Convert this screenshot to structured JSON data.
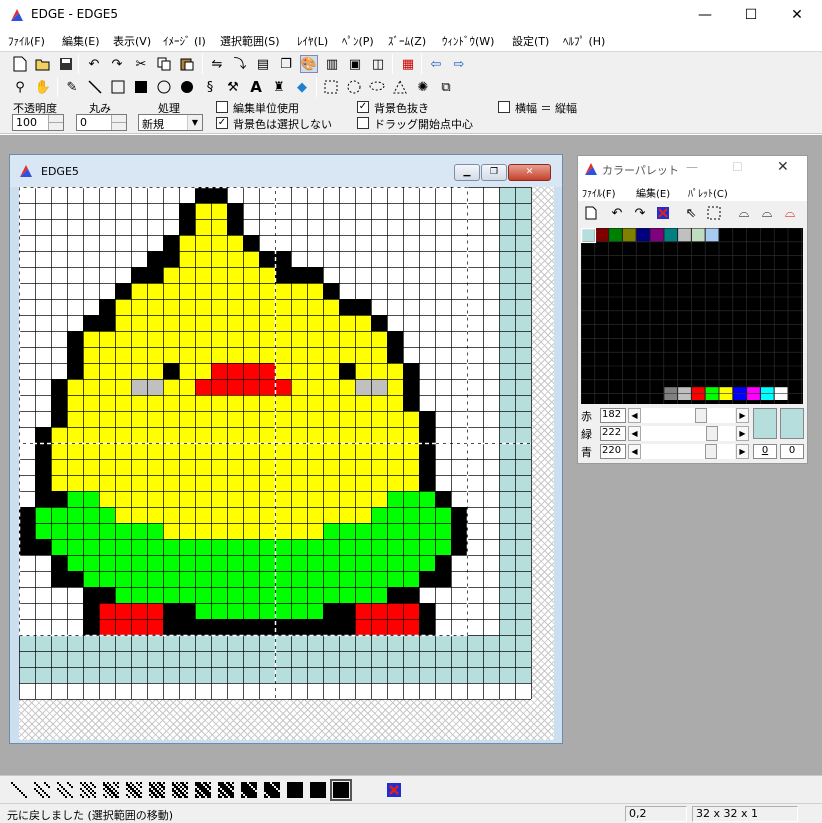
{
  "app": {
    "title": "EDGE - EDGE5",
    "min_glyph": "—",
    "max_glyph": "☐",
    "close_glyph": "✕"
  },
  "menu": [
    "ﾌｧｲﾙ(F)",
    "編集(E)",
    "表示(V)",
    "ｲﾒｰｼﾞ (I)",
    "選択範囲(S)",
    "ﾚｲﾔ(L)",
    "ﾍﾟﾝ(P)",
    "ｽﾞｰﾑ(Z)",
    "ｳｨﾝﾄﾞｳ(W)",
    "設定(T)",
    "ﾍﾙﾌﾟ (H)"
  ],
  "toolbar1_icons": [
    "new-icon",
    "open-icon",
    "save-icon",
    "undo-icon",
    "redo-icon",
    "cut-icon",
    "copy-icon",
    "paste-icon",
    "flip-h-icon",
    "flip-v-icon",
    "tile-icon",
    "layer-icon",
    "palette-icon",
    "film-icon",
    "image-icon",
    "frame-icon",
    "grid-icon",
    "prev-icon",
    "next-icon"
  ],
  "toolbar2_icons": [
    "zoom-icon",
    "hand-icon",
    "pencil-icon",
    "line-icon",
    "rect-icon",
    "fill-rect-icon",
    "ellipse-icon",
    "fill-ellipse-icon",
    "curve-icon",
    "hammer-icon",
    "text-icon",
    "spray-icon",
    "bucket-icon",
    "rect-select-icon",
    "ellipse-select-icon",
    "lasso-select-icon",
    "poly-select-icon",
    "magic-select-icon",
    "move-select-icon"
  ],
  "options": {
    "opacity_label": "不透明度",
    "opacity_value": "100",
    "round_label": "丸み",
    "round_value": "0",
    "process_label": "処理",
    "process_value": "新規",
    "edit_unit_label": "編集単位使用",
    "edit_unit_checked": false,
    "no_bg_select_label": "背景色は選択しない",
    "no_bg_select_checked": true,
    "bg_clear_label": "背景色抜き",
    "bg_clear_checked": true,
    "drag_center_label": "ドラッグ開始点中心",
    "drag_center_checked": false,
    "aspect_label": "横幅 ＝ 縦幅",
    "aspect_checked": false
  },
  "editor": {
    "title": "EDGE5",
    "canvas_size": 32
  },
  "sprite": {
    "colors": {
      ".": "#ffffff",
      "K": "#000000",
      "Y": "#ffff00",
      "G": "#00ff00",
      "R": "#ff0000",
      "A": "#c0c0c0",
      "B": "#b6dedc",
      "N": "#ffffff"
    },
    "rows": [
      "...........KK.................BB",
      "..........KYYK................BB",
      "..........KYYK................BB",
      ".........KYYYYK...............BB",
      "........KKYYYYYKK.............BB",
      ".......KKYYYYYYYKKK...........BB",
      "......KYYYYYYYYYYYYK..........BB",
      ".....KYYYYYYYYYYYYYYKK........BB",
      "....KKYYYYYYYYYYYYYYYYK.......BB",
      "...KYYYYYYYYYYYYYYYYYYYK......BB",
      "...KYYYYYYYYYYYYYYYYYYYK......BB",
      "...KYYYYYKYYRRRRYYYYKYYYK.....BB",
      "..KYYYYAAYYRRRRRRYYYYAAYK.....BB",
      "..KYYYYYYYYYYYYYYYYYYYYYK.....BB",
      "..KYYYYYYYYYYYYYYYYYYYYYYK....BB",
      ".KYYYYYYYYYYYYYYYYYYYYYYYK....BB",
      ".KYYYYYYYYYYYYYYYYYYYYYYYK....BB",
      ".KYYYYYYYYYYYYYYYYYYYYYYYK....BB",
      ".KYYYYYYYYYYYYYYYYYYYYYYYK....BB",
      ".KKGGYYYYYYYYYYYYYYYYYYGGGK...BB",
      "KGGGGGYYYYYYYYYYYYYYYYGGGGGK..BB",
      "KGGGGGGGGYYYYYYYYYYGGGGGGGGK..BB",
      "KKGGGGGGGGGGGGGGGGGGGGGGGGGK..BB",
      "..KGGGGGGGGGGGGGGGGGGGGGGGK...BB",
      "..KKGGGGGGGGGGGGGGGGGGGGGKK...BB",
      "....KKGGGGGGGGGGGGGGGGGKK.....BB",
      "....KRRRRKKGGGGGGGGKKRRRRK....BB",
      "....KRRRRKKKKKKKKKKKKRRRRK....BB",
      "BBBBBBBBBBBBBBBBBBBBBBBBBBBBBBBB",
      "BBBBBBBBBBBBBBBBBBBBBBBBBBBBBBBB",
      "BBBBBBBBBBBBBBBBBBBBBBBBBBBBBBBB",
      "NNNNNNNNNNNNNNNNNNNNNNNNNNNNNNNN"
    ]
  },
  "palette": {
    "title": "カラーパレット",
    "menu": [
      "ﾌｧｲﾙ(F)",
      "編集(E)",
      "ﾊﾟﾚｯﾄ(C)"
    ],
    "top_colors": [
      "#b6dedc",
      "#800000",
      "#008000",
      "#808000",
      "#000080",
      "#800080",
      "#008080",
      "#c0c0c0",
      "#c0dcc0",
      "#a6caf0"
    ],
    "bottom_colors": [
      "#808080",
      "#c0c0c0",
      "#ff0000",
      "#00ff00",
      "#ffff00",
      "#0000ff",
      "#ff00ff",
      "#00ffff",
      "#ffffff"
    ],
    "rgb": [
      {
        "label": "赤",
        "value": "182"
      },
      {
        "label": "緑",
        "value": "222"
      },
      {
        "label": "青",
        "value": "220"
      }
    ],
    "swatch_color": "#b6dedc",
    "fg_index": "0",
    "bg_index": "0"
  },
  "status": {
    "message": "元に戻しました (選択範囲の移動)",
    "coords": "0,2",
    "size": "32 x 32 x 1"
  }
}
